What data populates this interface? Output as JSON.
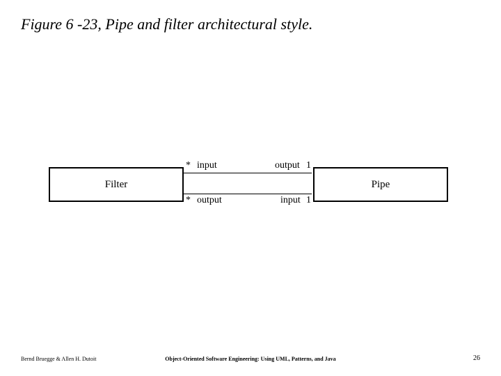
{
  "title": "Figure 6 -23, Pipe and filter architectural style.",
  "classes": {
    "filter": "Filter",
    "pipe": "Pipe"
  },
  "assoc": {
    "top": {
      "left_mult": "*",
      "left_role": "input",
      "right_role": "output",
      "right_mult": "1"
    },
    "bottom": {
      "left_mult": "*",
      "left_role": "output",
      "right_role": "input",
      "right_mult": "1"
    }
  },
  "footer": {
    "authors": "Bernd Bruegge & Allen H. Dutoit",
    "book": "Object-Oriented Software Engineering: Using UML, Patterns, and Java",
    "page": "26"
  }
}
